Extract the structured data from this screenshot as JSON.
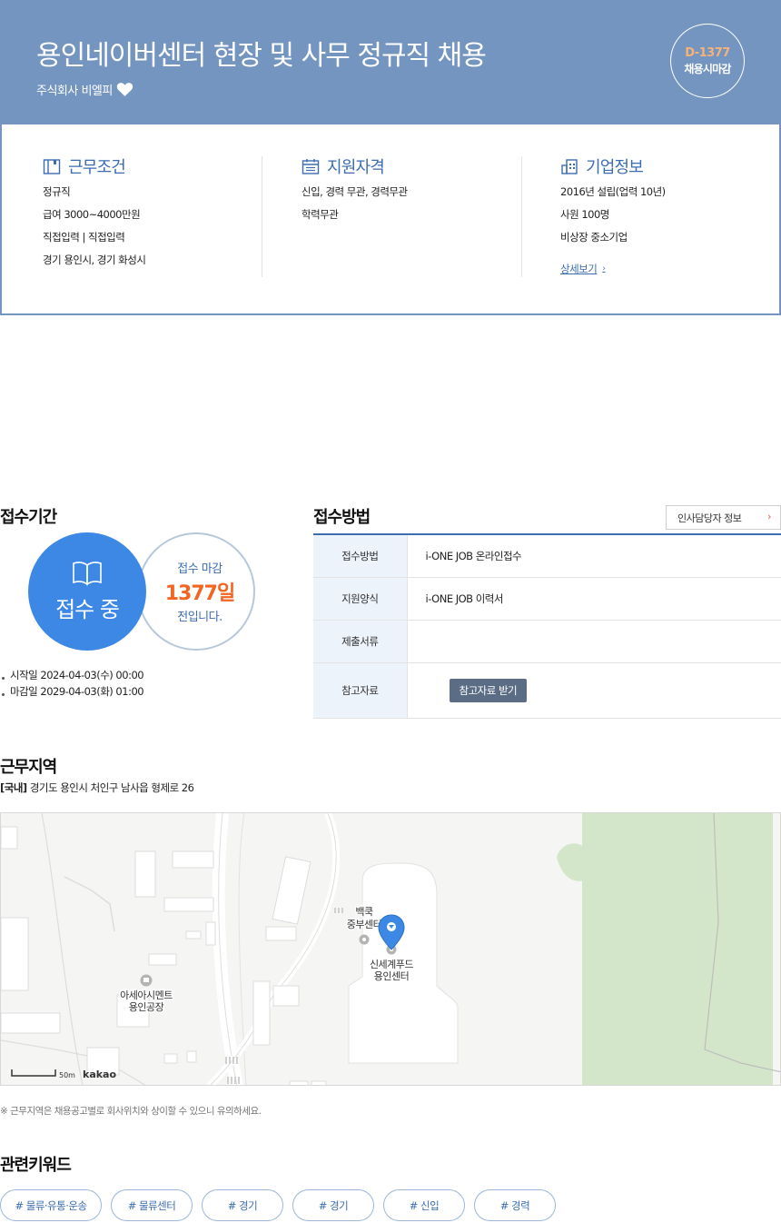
{
  "header": {
    "title": "용인네이버센터 현장 및 사무 정규직 채용",
    "company": "주식회사 비엘피",
    "dday": "D-1377",
    "dday_label": "채용시마감"
  },
  "summary": {
    "conditions": {
      "title": "근무조건",
      "lines": [
        "정규직",
        "급여 3000~4000만원",
        "직접입력 | 직접입력",
        "경기 용인시, 경기 화성시"
      ]
    },
    "qualifications": {
      "title": "지원자격",
      "lines": [
        "신입, 경력 무관, 경력무관",
        "학력무관"
      ]
    },
    "company_info": {
      "title": "기업정보",
      "lines": [
        "2016년 설립(업력 10년)",
        "사원 100명",
        "비상장 중소기업"
      ],
      "detail_link": "상세보기"
    }
  },
  "period": {
    "title": "접수기간",
    "status": "접수 중",
    "deadline_label": "접수 마감",
    "deadline_days": "1377일",
    "deadline_suffix": "전입니다.",
    "start": "시작일 2024-04-03(수) 00:00",
    "end": "마감일 2029-04-03(화) 01:00"
  },
  "method": {
    "title": "접수방법",
    "hr_button": "인사담당자 정보",
    "rows": [
      {
        "label": "접수방법",
        "value": "i-ONE JOB 온라인접수"
      },
      {
        "label": "지원양식",
        "value": "i-ONE JOB 이력서"
      },
      {
        "label": "제출서류",
        "value": ""
      },
      {
        "label": "참고자료",
        "button": "참고자료 받기"
      }
    ]
  },
  "location": {
    "title": "근무지역",
    "region_tag": "[국내]",
    "address": "경기도 용인시 처인구 남사읍 형제로 26",
    "map_labels": {
      "poi1_line1": "백쿡",
      "poi1_line2": "중부센터",
      "poi2_line1": "신세계푸드",
      "poi2_line2": "용인센터",
      "poi3_line1": "아세아시멘트",
      "poi3_line2": "용인공장",
      "scale": "50m",
      "brand": "kakao"
    },
    "note": "※ 근무지역은 채용공고별로 회사위치와 상이할 수 있으니 유의하세요."
  },
  "keywords": {
    "title": "관련키워드",
    "items": [
      "# 물류·유통·운송",
      "# 물류센터",
      "# 경기",
      "# 경기",
      "# 신입",
      "# 경력"
    ]
  }
}
